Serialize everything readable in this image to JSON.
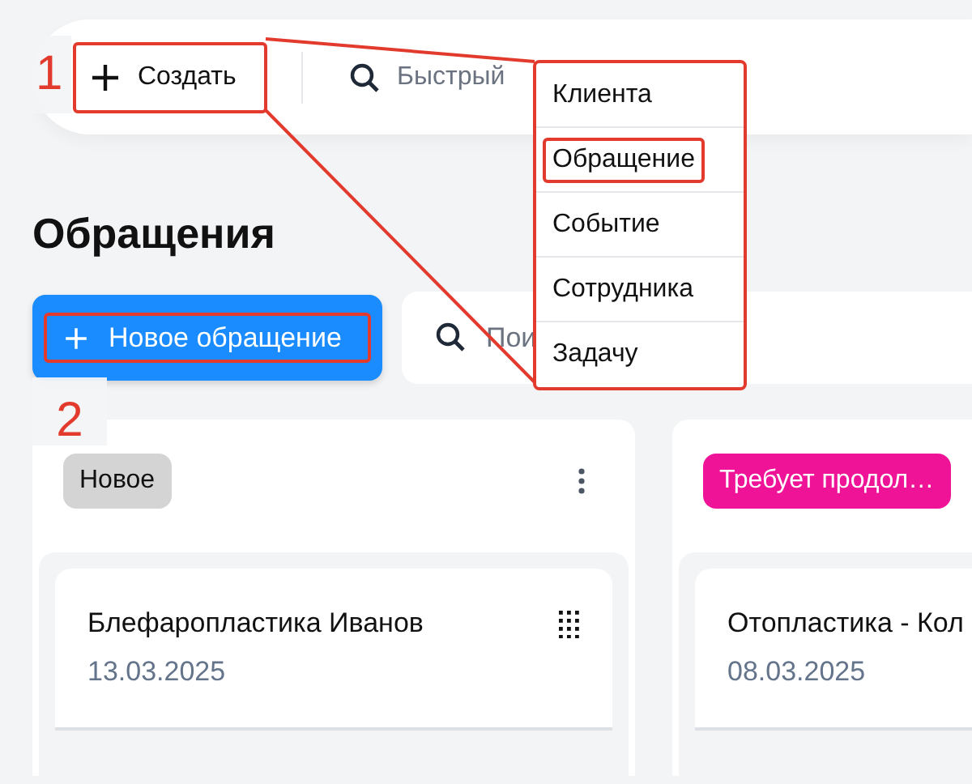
{
  "topbar": {
    "create_button": {
      "label": "Создать",
      "highlighted": true
    },
    "search": {
      "placeholder": "Быстрый"
    }
  },
  "create_menu": {
    "items": [
      {
        "label": "Клиента",
        "selected": false
      },
      {
        "label": "Обращение",
        "selected": true
      },
      {
        "label": "Событие",
        "selected": false
      },
      {
        "label": "Сотрудника",
        "selected": false
      },
      {
        "label": "Задачу",
        "selected": false
      }
    ]
  },
  "page_title": "Обращения",
  "new_button": {
    "label": "Новое обращение",
    "highlighted": true
  },
  "search": {
    "placeholder": "Пои"
  },
  "columns": [
    {
      "status": "Новое",
      "color": "#d4d4d4",
      "cards": [
        {
          "title": "Блефаропластика Иванов",
          "date": "13.03.2025"
        }
      ]
    },
    {
      "status": "Требует продол…",
      "color": "#ef1397",
      "cards": [
        {
          "title": "Отопластика - Кол",
          "date": "08.03.2025"
        }
      ]
    }
  ],
  "steps": [
    "1",
    "2"
  ]
}
